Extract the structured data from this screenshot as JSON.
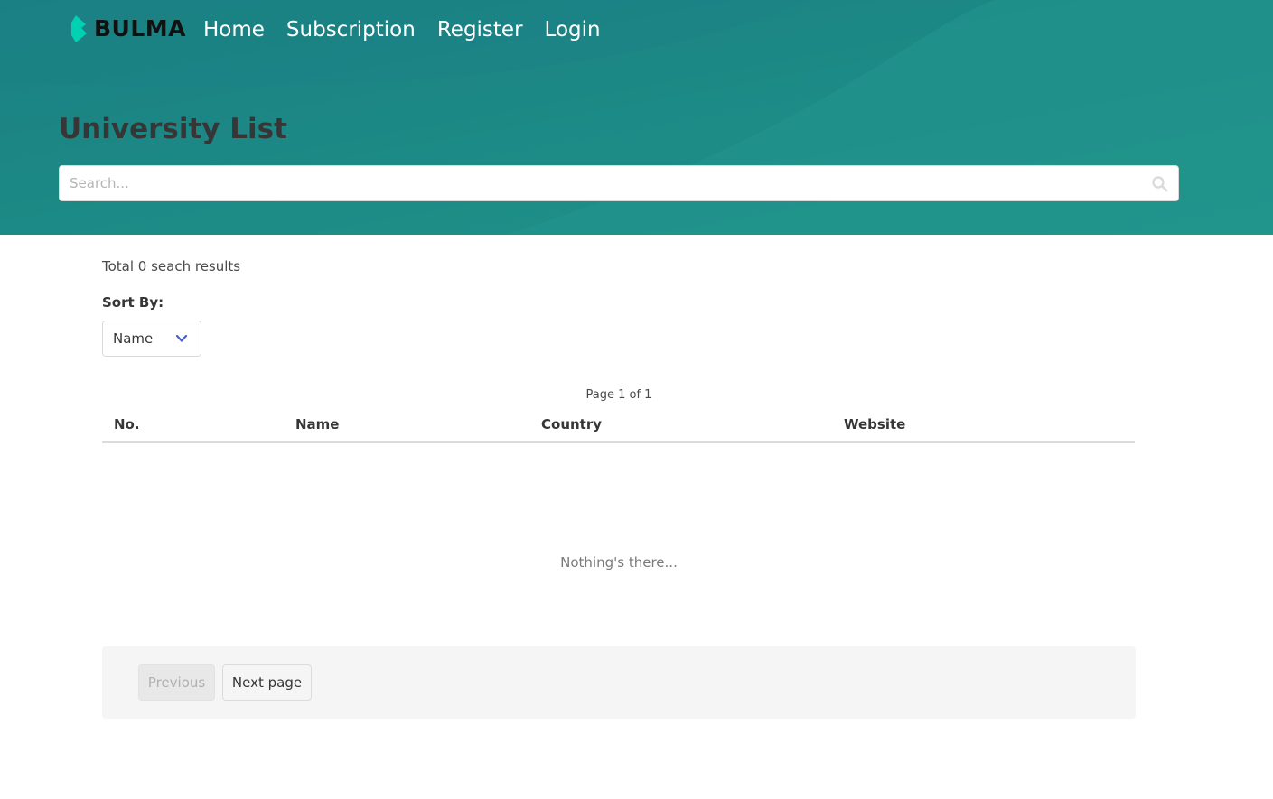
{
  "navbar": {
    "brand": "BULMA",
    "links": [
      "Home",
      "Subscription",
      "Register",
      "Login"
    ]
  },
  "hero": {
    "title": "University List",
    "search_placeholder": "Search..."
  },
  "results": {
    "count_text": "Total 0 seach results",
    "sort_label": "Sort By:",
    "sort_value": "Name",
    "page_indicator": "Page 1 of 1"
  },
  "table": {
    "headers": [
      "No.",
      "Name",
      "Country",
      "Website"
    ],
    "rows": [],
    "empty_message": "Nothing's there..."
  },
  "pagination": {
    "previous_label": "Previous",
    "next_label": "Next page"
  },
  "colors": {
    "hero_background": "#1f8a87",
    "brand_mark": "#00d1b2",
    "sort_chevron": "#485fc7"
  }
}
